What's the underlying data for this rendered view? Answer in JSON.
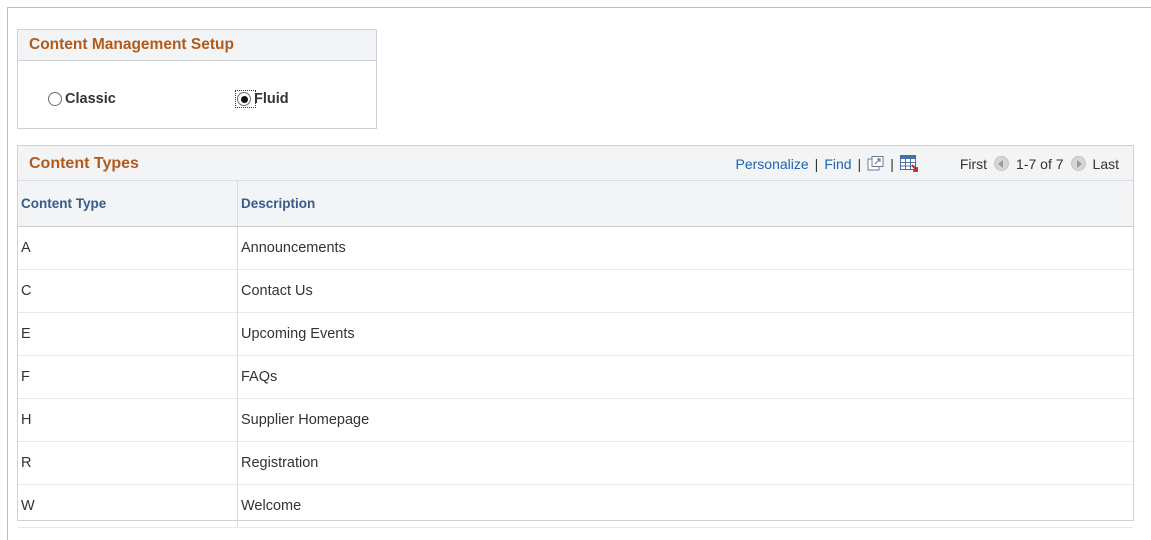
{
  "setup": {
    "title": "Content Management Setup",
    "options": [
      {
        "label": "Classic",
        "selected": false
      },
      {
        "label": "Fluid",
        "selected": true
      }
    ]
  },
  "grid": {
    "title": "Content Types",
    "personalize": "Personalize",
    "find": "Find",
    "separator": "|",
    "first": "First",
    "range": "1-7 of 7",
    "last": "Last",
    "icons": [
      "view-all-icon",
      "download-spreadsheet-icon",
      "previous-arrow-icon",
      "next-arrow-icon"
    ],
    "columns": [
      "Content Type",
      "Description"
    ],
    "rows": [
      {
        "type": "A",
        "description": "Announcements"
      },
      {
        "type": "C",
        "description": "Contact Us"
      },
      {
        "type": "E",
        "description": "Upcoming Events"
      },
      {
        "type": "F",
        "description": "FAQs"
      },
      {
        "type": "H",
        "description": "Supplier Homepage"
      },
      {
        "type": "R",
        "description": "Registration"
      },
      {
        "type": "W",
        "description": "Welcome"
      }
    ]
  },
  "colors": {
    "section_title": "#b15b1b",
    "link": "#1f63ad",
    "column_header": "#3a5a8a",
    "header_bg": "#f2f4f6"
  }
}
